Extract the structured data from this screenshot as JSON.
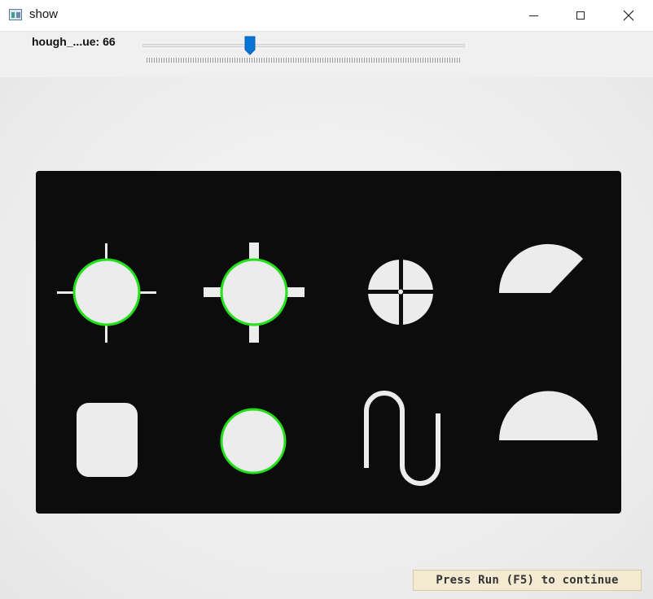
{
  "window": {
    "title": "show"
  },
  "trackbar": {
    "label": "hough_...ue: 66",
    "value": 66
  },
  "overlay": {
    "hint": "Press Run (F5) to continue"
  },
  "colors": {
    "detection_circle": "#22e01a",
    "slider_thumb": "#0a74d6",
    "board": "#0c0c0c",
    "shape_fill": "#ececec"
  }
}
